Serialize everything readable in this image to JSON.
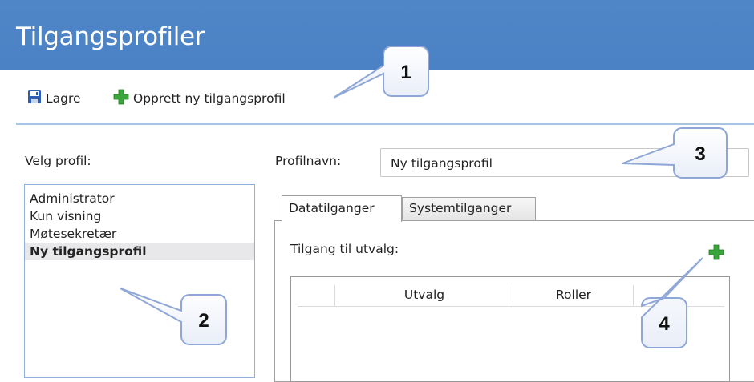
{
  "window": {
    "title": "Tilgangsprofiler"
  },
  "toolbar": {
    "save_label": "Lagre",
    "create_label": "Opprett ny tilgangsprofil"
  },
  "profiles": {
    "label": "Velg profil:",
    "items": [
      "Administrator",
      "Kun visning",
      "Møtesekretær",
      "Ny tilgangsprofil"
    ],
    "selected": "Ny tilgangsprofil"
  },
  "profile_name": {
    "label": "Profilnavn:",
    "value": "Ny tilgangsprofil"
  },
  "tabs": [
    "Datatilganger",
    "Systemtilganger"
  ],
  "active_tab": "Datatilganger",
  "access": {
    "label": "Tilgang til utvalg:",
    "columns": [
      "Utvalg",
      "Roller"
    ]
  },
  "callouts": [
    "1",
    "2",
    "3",
    "4"
  ],
  "colors": {
    "titlebar": "#4a82c5",
    "divider": "#a9c4e2",
    "accent_green": "#3aa53a"
  },
  "icons": {
    "save": "floppy-disk-icon",
    "create": "green-plus-icon",
    "add_access": "green-plus-icon"
  }
}
